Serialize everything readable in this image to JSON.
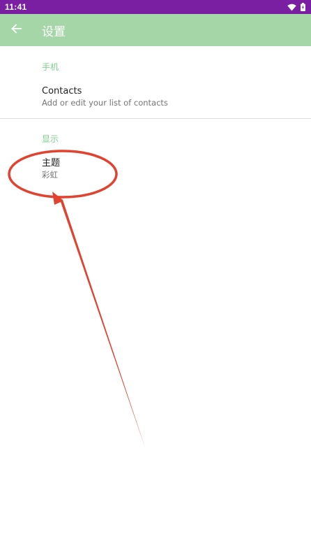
{
  "status_bar": {
    "time": "11:41",
    "icons": [
      "wifi-icon",
      "battery-icon"
    ]
  },
  "app_bar": {
    "back_icon": "arrow-back-icon",
    "title": "设置"
  },
  "preferences": {
    "phone_category": "手机",
    "contacts": {
      "title": "Contacts",
      "summary": "Add or edit your list of contacts"
    },
    "display_category": "显示",
    "theme": {
      "title": "主题",
      "summary": "彩虹"
    }
  },
  "colors": {
    "status_bar": "#7b1fa2",
    "app_bar": "#a5d6a7",
    "category_text": "#7fcf8c",
    "annotation": "#e0432f"
  }
}
